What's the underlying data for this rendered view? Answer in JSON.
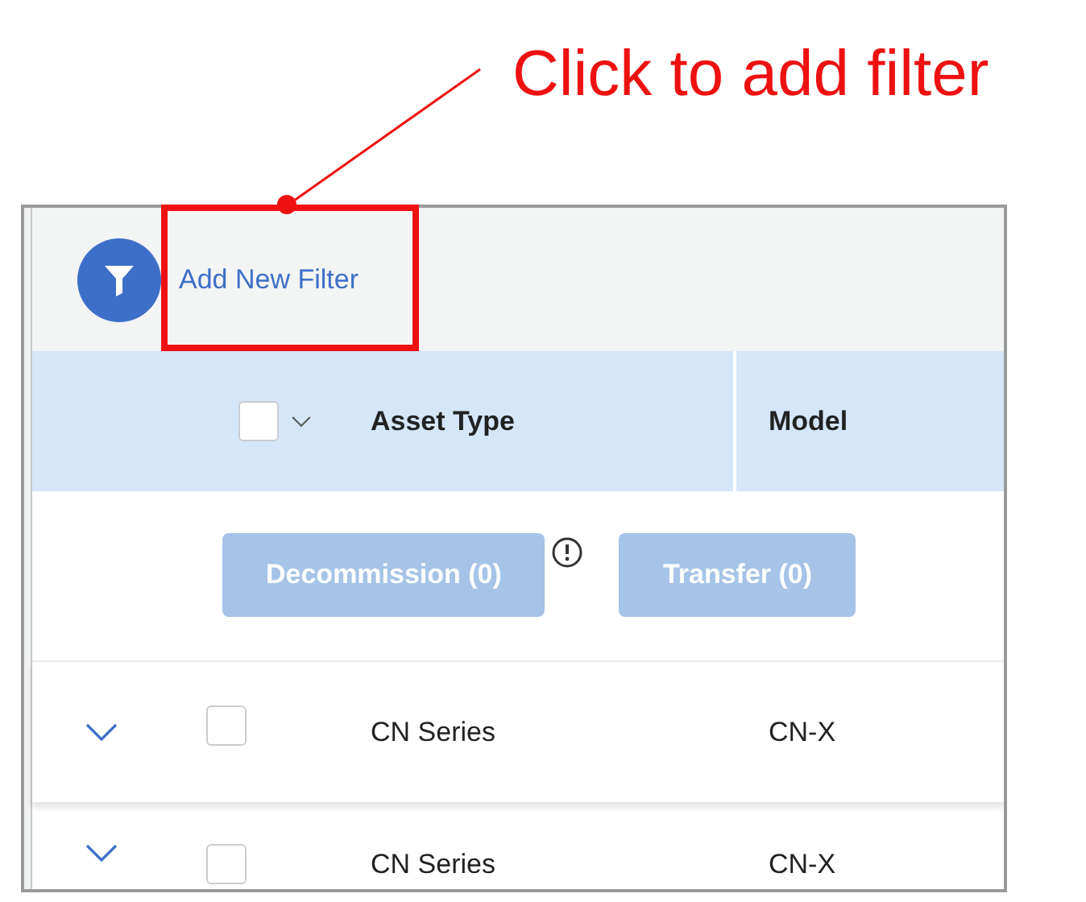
{
  "annotation": {
    "text": "Click to add filter"
  },
  "filter_bar": {
    "label": "Add New Filter"
  },
  "table": {
    "select_all": {
      "checked": false
    },
    "columns": [
      "Asset Type",
      "Model"
    ],
    "actions": [
      {
        "label": "Decommission (0)",
        "disabled": true,
        "info": true
      },
      {
        "label": "Transfer (0)",
        "disabled": true,
        "info": false
      }
    ],
    "rows": [
      {
        "expanded": false,
        "checked": false,
        "cells": [
          "CN Series",
          "CN-X"
        ]
      },
      {
        "expanded": false,
        "checked": false,
        "cells": [
          "CN Series",
          "CN-X"
        ]
      }
    ]
  }
}
